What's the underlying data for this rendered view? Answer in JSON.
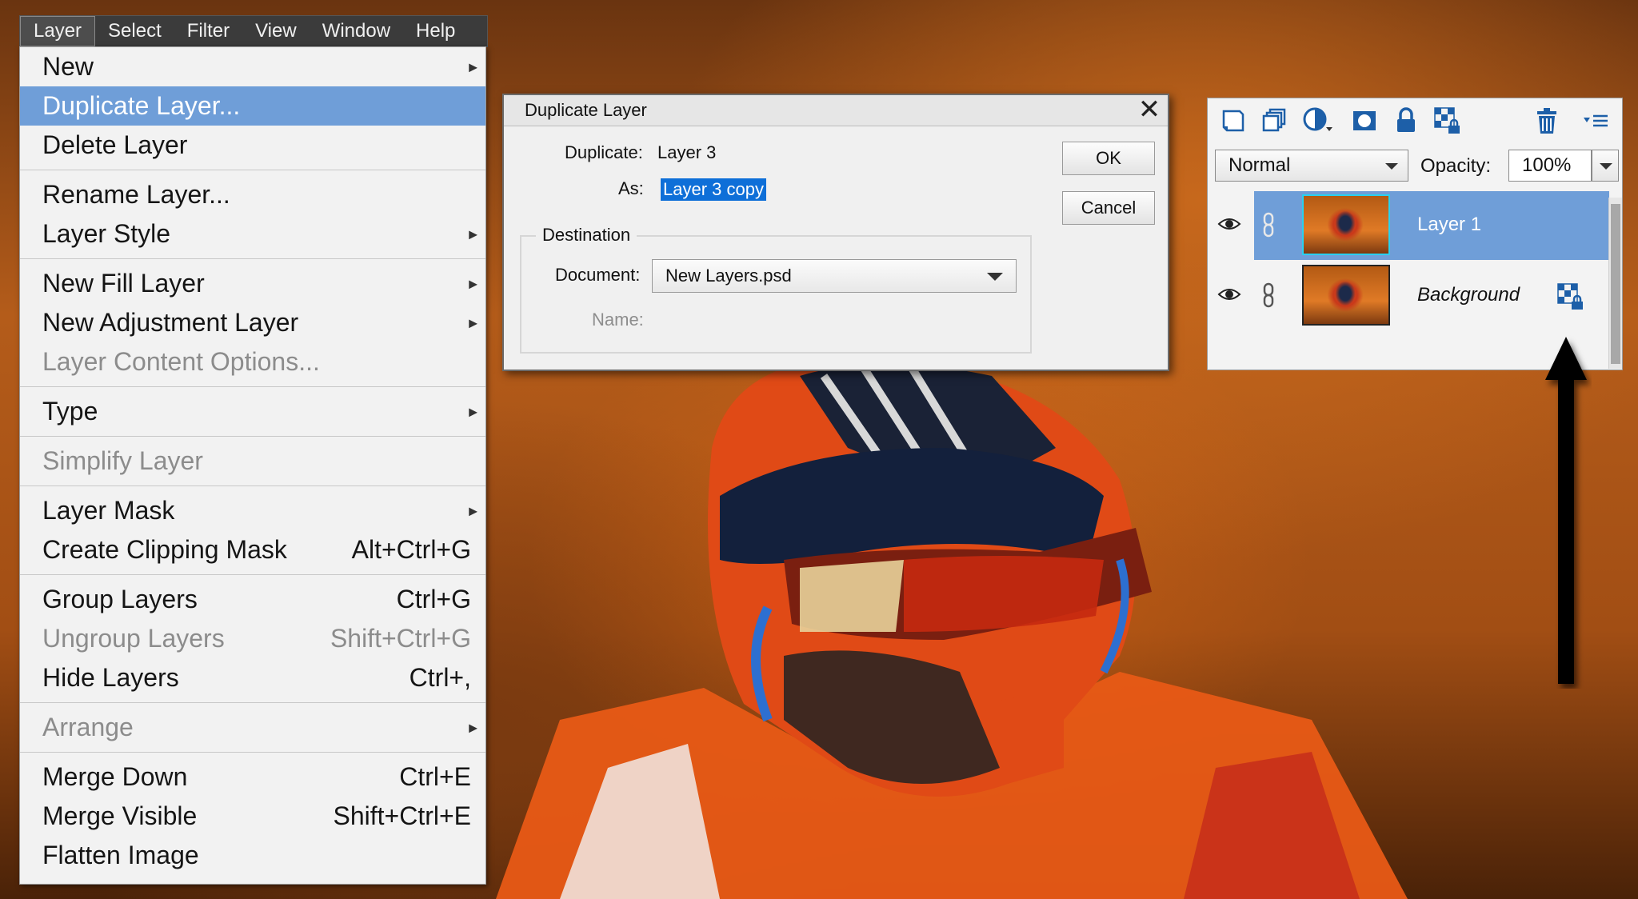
{
  "menubar": {
    "items": [
      "Layer",
      "Select",
      "Filter",
      "View",
      "Window",
      "Help"
    ]
  },
  "menu": {
    "new": "New",
    "duplicate_layer": "Duplicate Layer...",
    "delete_layer": "Delete Layer",
    "rename_layer": "Rename Layer...",
    "layer_style": "Layer Style",
    "new_fill_layer": "New Fill Layer",
    "new_adjustment_layer": "New Adjustment Layer",
    "layer_content_options": "Layer Content Options...",
    "type": "Type",
    "simplify_layer": "Simplify Layer",
    "layer_mask": "Layer Mask",
    "create_clipping_mask": "Create Clipping Mask",
    "create_clipping_mask_shortcut": "Alt+Ctrl+G",
    "group_layers": "Group Layers",
    "group_layers_shortcut": "Ctrl+G",
    "ungroup_layers": "Ungroup Layers",
    "ungroup_layers_shortcut": "Shift+Ctrl+G",
    "hide_layers": "Hide Layers",
    "hide_layers_shortcut": "Ctrl+,",
    "arrange": "Arrange",
    "merge_down": "Merge Down",
    "merge_down_shortcut": "Ctrl+E",
    "merge_visible": "Merge Visible",
    "merge_visible_shortcut": "Shift+Ctrl+E",
    "flatten_image": "Flatten Image"
  },
  "dialog": {
    "title": "Duplicate Layer",
    "close_glyph": "✕",
    "duplicate_label": "Duplicate:",
    "duplicate_value": "Layer 3",
    "as_label": "As:",
    "as_value": "Layer 3 copy",
    "destination_label": "Destination",
    "document_label": "Document:",
    "document_value": "New Layers.psd",
    "name_label": "Name:",
    "ok_label": "OK",
    "cancel_label": "Cancel"
  },
  "layers_panel": {
    "blend_mode": "Normal",
    "opacity_label": "Opacity:",
    "opacity_value": "100%",
    "layers": [
      {
        "name": "Layer 1",
        "selected": true
      },
      {
        "name": "Background",
        "selected": false,
        "locked": true
      }
    ],
    "toolbar_icons": [
      "new-layer-icon",
      "new-group-icon",
      "adjustment-layer-icon",
      "layer-mask-icon",
      "lock-all-icon",
      "lock-transparency-icon",
      "delete-layer-icon",
      "panel-menu-icon"
    ]
  },
  "colors": {
    "menu_highlight": "#6f9ed8",
    "selection_blue": "#0e6fd8",
    "menubar_bg": "#3b3b3b"
  }
}
